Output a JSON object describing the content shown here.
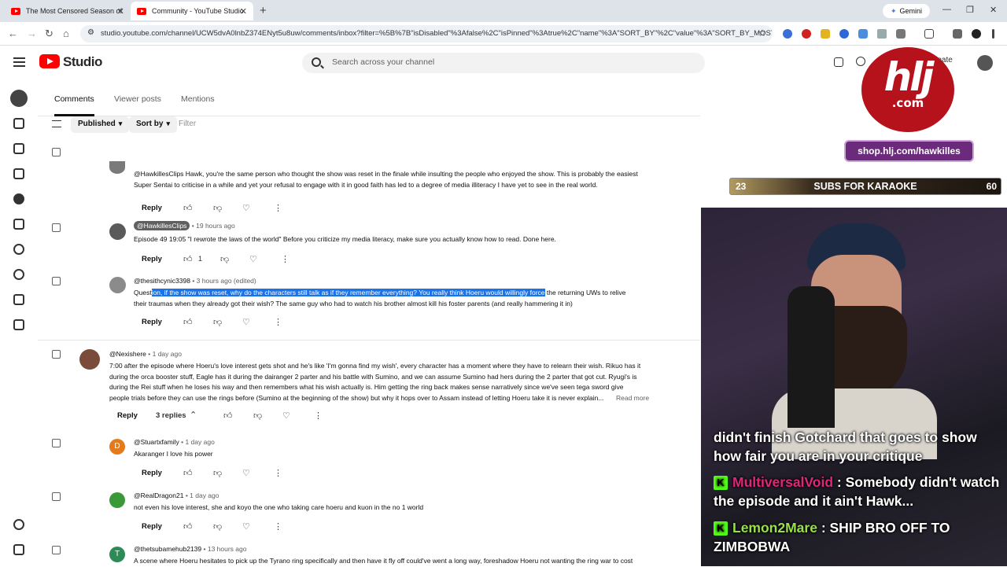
{
  "browser": {
    "tabs": [
      {
        "title": "The Most Censored Season of "
      },
      {
        "title": "Community - YouTube Studio"
      }
    ],
    "new_tab": "+",
    "gemini": "Gemini",
    "url": "studio.youtube.com/channel/UCW5dvA0lnbZ374ENyt5u8uw/comments/inbox?filter=%5B%7B\"isDisabled\"%3Afalse%2C\"isPinned\"%3Atrue%2C\"name\"%3A\"SORT_BY\"%2C\"value\"%3A\"SORT_BY_MOST..."
  },
  "app": {
    "logo_text": "Studio",
    "search_placeholder": "Search across your channel",
    "create_label": "reate"
  },
  "tabs": [
    "Comments",
    "Viewer posts",
    "Mentions"
  ],
  "filters": {
    "published": "Published",
    "sort": "Sort by",
    "filter_placeholder": "Filter"
  },
  "actions": {
    "reply": "Reply",
    "read_more": "Read more"
  },
  "comments": [
    {
      "author": "@HawkillesClips",
      "time": "",
      "text": "Hawk, you're the same person who thought the show was reset in the finale while insulting the people who enjoyed the show. This is probably the easiest Super Sentai to criticise in a while and yet your refusal to engage with it in good faith has led to a degree of media illiteracy I have yet to see in the real world."
    },
    {
      "author": "@HawkillesClips",
      "time": "19 hours ago",
      "text": "Episode 49 19:05 \"I rewrote the laws of the world\" Before you criticize my media literacy, make sure you actually know how to read. Done here.",
      "likes": "1"
    },
    {
      "author": "@thesithcynic3398",
      "time": "3 hours ago (edited)",
      "text_pre": "Quest",
      "text_hl": "ion, if the show was reset, why do the characters still talk as if they remember everything? You really think Hoeru would willingly force",
      "text_post": " the returning UWs to relive their traumas when they already got their wish? The same guy who had to watch his brother almost kill his foster parents (and really hammering it in)"
    },
    {
      "author": "@Nexishere",
      "time": "1 day ago",
      "text": "7:00 after the episode where Hoeru's love interest gets shot and he's like 'I'm gonna find my wish', every character has a moment where they have to relearn their wish. Rikuo has it during the orca booster stuff, Eagle has it during the dairanger 2 parter and his battle with Sumino, and we can assume Sumino had hers during the 2 parter that got cut. Ryugi's is during the Rei stuff when he loses his way and then remembers what his wish actually is. Him getting the ring back makes sense narratively since we've seen tega sword give people trials before they can use the rings before (Sumino at the beginning of the show) but why it hops over to Assam instead of letting Hoeru take it is never explain...",
      "replies": "3 replies"
    },
    {
      "author": "@Stuartxfamily",
      "time": "1 day ago",
      "avatar_letter": "D",
      "text": "Akaranger  I love his power"
    },
    {
      "author": "@RealDragon21",
      "time": "1 day ago",
      "text": "not even his love interest, she and koyo the one who taking care hoeru and kuon in the no 1 world"
    },
    {
      "author": "@thetsubamehub2139",
      "time": "13 hours ago",
      "avatar_letter": "T",
      "text": "A scene where Hoeru hesitates to pick up the Tyrano ring specifically and then have it fly off could've went a long way, foreshadow Hoeru not wanting the ring war to cost"
    }
  ],
  "stream": {
    "logo_main": "hlj",
    "logo_sub": ".com",
    "shop": "shop.hlj.com/hawkilles",
    "subs_label": "SUBS FOR KARAOKE",
    "subs_current": "23",
    "subs_goal": "60",
    "chat": [
      {
        "user": "",
        "text": "didn't finish Gotchard that goes to show how fair you are in your critique"
      },
      {
        "user": "MultiversalVoid",
        "text": " : Somebody didn't watch the episode and it ain't Hawk..."
      },
      {
        "user": "Lemon2Mare",
        "text": " : SHIP BRO OFF TO ZIMBOBWA"
      }
    ]
  },
  "colors": {
    "accent": "#065fd4",
    "highlight": "#1a73e8",
    "kick": "#53fc18"
  }
}
